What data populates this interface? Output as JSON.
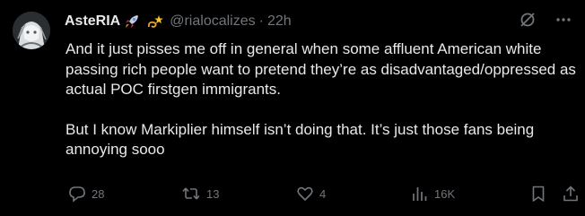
{
  "post": {
    "display_name": "AsteRIA",
    "name_emojis": [
      "rocket-emoji",
      "dizzy-emoji"
    ],
    "handle": "@rialocalizes",
    "separator": "·",
    "time": "22h",
    "paragraphs": [
      "And it just pisses me off in general when some affluent American white passing rich people want to pretend they’re as disadvantaged/oppressed as actual POC firstgen immigrants.",
      "But I know Markiplier himself isn’t doing that. It’s just those fans being annoying sooo"
    ],
    "actions": {
      "replies": "28",
      "reposts": "13",
      "likes": "4",
      "views": "16K"
    }
  },
  "icons": [
    "grok-icon",
    "more-icon",
    "reply-icon",
    "repost-icon",
    "like-icon",
    "views-icon",
    "bookmark-icon",
    "share-icon"
  ],
  "colors": {
    "background": "#000000",
    "text": "#e7e9ea",
    "muted": "#71767b"
  }
}
